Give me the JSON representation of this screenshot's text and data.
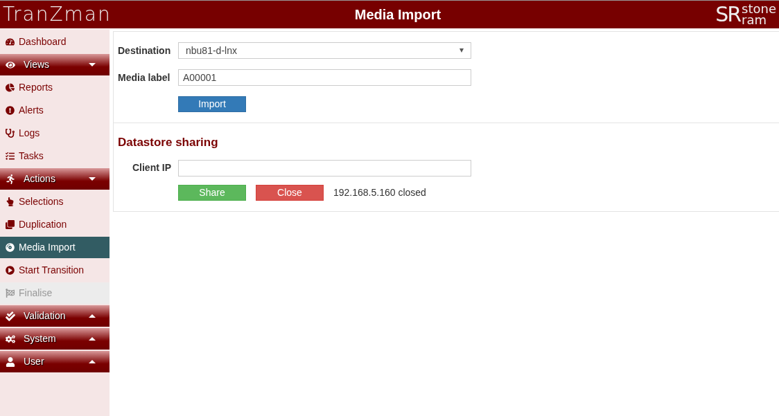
{
  "header": {
    "logo": "TranZman",
    "title": "Media Import",
    "brand": {
      "mark": "SR",
      "line1": "stone",
      "line2": "ram"
    }
  },
  "sidebar": {
    "items": [
      {
        "kind": "link",
        "label": "Dashboard",
        "selected": false,
        "disabled": false
      },
      {
        "kind": "section",
        "label": "Views",
        "expanded": true
      },
      {
        "kind": "link",
        "label": "Reports",
        "selected": false,
        "disabled": false
      },
      {
        "kind": "link",
        "label": "Alerts",
        "selected": false,
        "disabled": false
      },
      {
        "kind": "link",
        "label": "Logs",
        "selected": false,
        "disabled": false
      },
      {
        "kind": "link",
        "label": "Tasks",
        "selected": false,
        "disabled": false
      },
      {
        "kind": "section",
        "label": "Actions",
        "expanded": true
      },
      {
        "kind": "link",
        "label": "Selections",
        "selected": false,
        "disabled": false
      },
      {
        "kind": "link",
        "label": "Duplication",
        "selected": false,
        "disabled": false
      },
      {
        "kind": "link",
        "label": "Media Import",
        "selected": true,
        "disabled": false
      },
      {
        "kind": "link",
        "label": "Start Transition",
        "selected": false,
        "disabled": false
      },
      {
        "kind": "link",
        "label": "Finalise",
        "selected": false,
        "disabled": true
      },
      {
        "kind": "section",
        "label": "Validation",
        "expanded": false
      },
      {
        "kind": "section",
        "label": "System",
        "expanded": false
      },
      {
        "kind": "section",
        "label": "User",
        "expanded": false
      }
    ]
  },
  "import_form": {
    "destination": {
      "label": "Destination",
      "value": "nbu81-d-lnx"
    },
    "media_label": {
      "label": "Media label",
      "value": "A00001"
    },
    "button": "Import"
  },
  "sharing": {
    "heading": "Datastore sharing",
    "client_ip": {
      "label": "Client IP"
    },
    "share_button": "Share",
    "close_button": "Close",
    "status": "192.168.5.160 closed"
  }
}
